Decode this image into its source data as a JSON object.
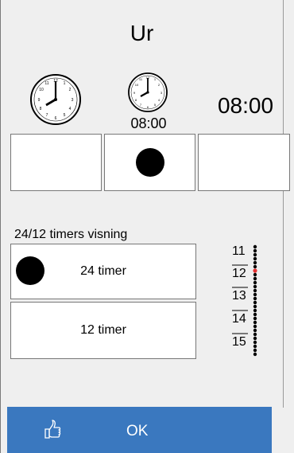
{
  "title": "Ur",
  "clock_options": {
    "analog_only": {
      "icon": "analog-clock-icon"
    },
    "analog_with_digital": {
      "icon": "analog-clock-icon",
      "digital_text": "08:00",
      "selected": true
    },
    "digital_only": {
      "digital_text": "08:00"
    }
  },
  "format_section": {
    "label": "24/12 timers visning",
    "options": [
      {
        "label": "24 timer",
        "selected": true
      },
      {
        "label": "12 timer",
        "selected": false
      }
    ]
  },
  "hour_scroller": {
    "values": [
      "11",
      "12",
      "13",
      "14",
      "15"
    ],
    "selected": "12"
  },
  "ok_bar": {
    "label": "OK",
    "icon": "thumbs-up-icon"
  },
  "colors": {
    "ok_bar": "#3a78bf",
    "panel": "#efefef",
    "indicator": "#e53030"
  }
}
